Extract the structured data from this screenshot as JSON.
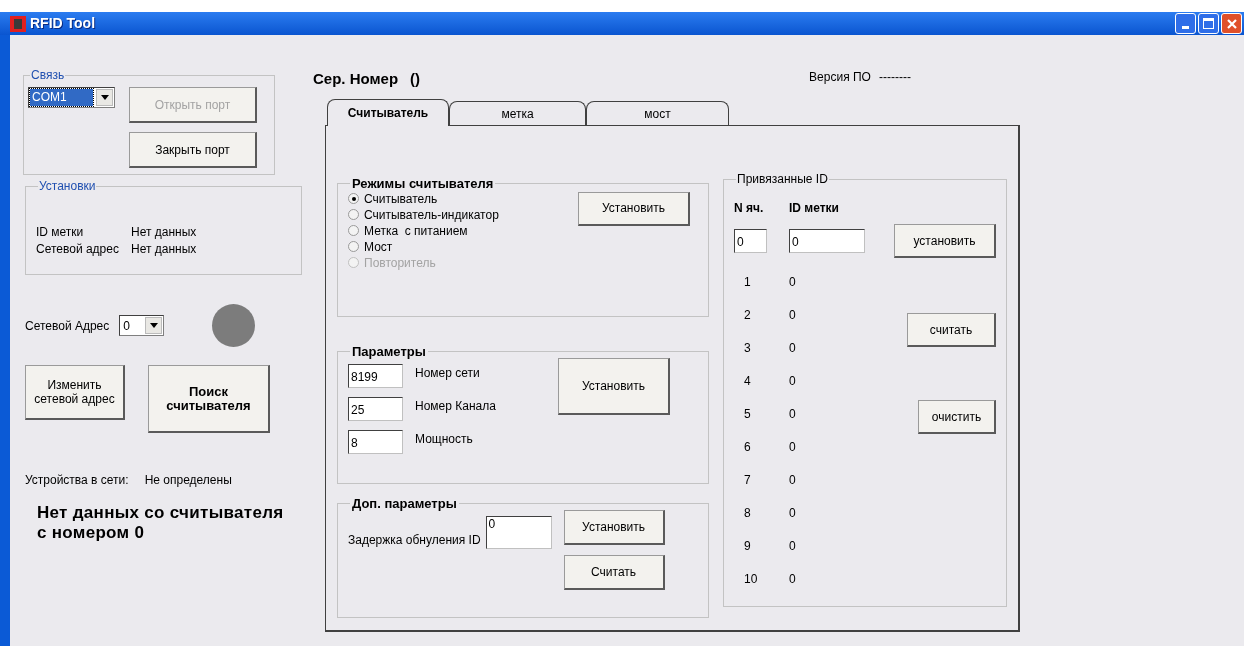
{
  "window": {
    "title": "RFID Tool"
  },
  "connection": {
    "legend": "Связь",
    "port": {
      "value": "COM1",
      "focused": true
    },
    "buttons": [
      {
        "label": "Открыть порт",
        "disabled": true
      },
      {
        "label": "Закрыть порт",
        "disabled": false
      }
    ]
  },
  "settings": {
    "legend": "Установки",
    "rows": [
      {
        "label": "ID метки",
        "value": "Нет данных"
      },
      {
        "label": "Сетевой адрес",
        "value": "Нет данных"
      }
    ]
  },
  "network_address": {
    "label": "Сетевой Адрес",
    "value": "0"
  },
  "left_buttons": [
    {
      "label": "Изменить сетевой адрес",
      "bold": false
    },
    {
      "label": "Поиск считывателя",
      "bold": true
    }
  ],
  "devices": {
    "label": "Устройства в сети:",
    "value": "Не определены"
  },
  "message": "Нет данных со считывателя с номером 0",
  "serial": {
    "label": "Сер. Номер",
    "value": "()"
  },
  "firmware": {
    "label": "Версия ПО",
    "value": "--------"
  },
  "tabs": [
    {
      "label": "Считыватель",
      "selected": true
    },
    {
      "label": "метка",
      "selected": false
    },
    {
      "label": "мост",
      "selected": false
    }
  ],
  "reader_modes": {
    "legend": "Режимы считывателя",
    "options": [
      {
        "label": "Считыватель",
        "selected": true,
        "disabled": false
      },
      {
        "label": "Считыватель-индикатор",
        "selected": false,
        "disabled": false
      },
      {
        "label": "Метка  с питанием",
        "selected": false,
        "disabled": false
      },
      {
        "label": "Мост",
        "selected": false,
        "disabled": false
      },
      {
        "label": "Повторитель",
        "selected": false,
        "disabled": true
      }
    ],
    "button": {
      "label": "Установить"
    }
  },
  "parameters": {
    "legend": "Параметры",
    "fields": [
      {
        "value": "8199",
        "label": "Номер сети"
      },
      {
        "value": "25",
        "label": "Номер Канала"
      },
      {
        "value": "8",
        "label": "Мощность"
      }
    ],
    "button": "Установить"
  },
  "extra_parameters": {
    "legend": "Доп. параметры",
    "label": "Задержка обнуления ID",
    "value": "0",
    "buttons": [
      "Установить",
      "Считать"
    ]
  },
  "bound_ids": {
    "legend": "Привязанные ID",
    "columns": [
      "N яч.",
      "ID метки"
    ],
    "inputs": [
      "0",
      "0"
    ],
    "rows": [
      {
        "cell": "1",
        "id": "0"
      },
      {
        "cell": "2",
        "id": "0"
      },
      {
        "cell": "3",
        "id": "0"
      },
      {
        "cell": "4",
        "id": "0"
      },
      {
        "cell": "5",
        "id": "0"
      },
      {
        "cell": "6",
        "id": "0"
      },
      {
        "cell": "7",
        "id": "0"
      },
      {
        "cell": "8",
        "id": "0"
      },
      {
        "cell": "9",
        "id": "0"
      },
      {
        "cell": "10",
        "id": "0"
      }
    ],
    "buttons": [
      "установить",
      "считать",
      "очистить"
    ]
  }
}
